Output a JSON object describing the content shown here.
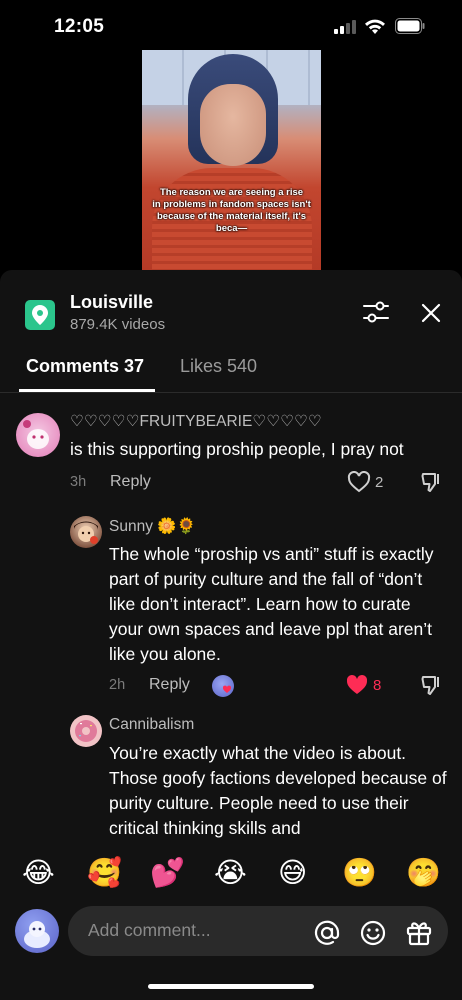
{
  "status_bar": {
    "time": "12:05"
  },
  "video": {
    "caption_lines": [
      "The reason we are seeing a rise",
      "in problems in fandom spaces isn't",
      "because of the material itself, it's beca—"
    ]
  },
  "place": {
    "title": "Louisville",
    "subtitle": "879.4K videos"
  },
  "tabs": {
    "comments": "Comments 37",
    "likes": "Likes 540"
  },
  "comments": [
    {
      "username": "♡♡♡♡♡FRUITYBEARIE♡♡♡♡♡",
      "text": "is this supporting proship people, I pray not",
      "time": "3h",
      "reply": "Reply",
      "likes": "2"
    },
    {
      "username": "Sunny 🌼🌻",
      "text": "The whole “proship vs anti” stuff is exactly part of purity culture and the fall of “don’t like don’t interact”. Learn how to curate your own spaces and leave ppl that aren’t like you alone.",
      "time": "2h",
      "reply": "Reply",
      "likes": "8"
    },
    {
      "username": "Cannibalism",
      "text": "You’re exactly what the video is about. Those goofy factions developed because of purity culture. People need to use their critical thinking skills and"
    }
  ],
  "emojis": [
    "😂",
    "🥰",
    "💕",
    "😭",
    "😅",
    "🙄",
    "🤭"
  ],
  "composer": {
    "placeholder": "Add comment..."
  },
  "colors": {
    "accent_red": "#fe2c55",
    "place_icon": "#2bc58c",
    "sheet_bg": "#121212"
  }
}
